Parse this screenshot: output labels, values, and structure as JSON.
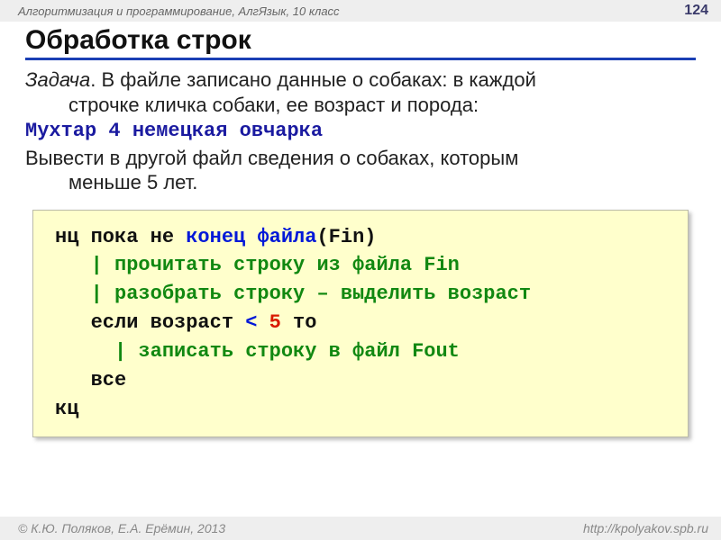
{
  "header": {
    "course": "Алгоритмизация и программирование, АлгЯзык, 10 класс",
    "page": "124"
  },
  "title": "Обработка строк",
  "task": {
    "label": "Задача",
    "line1_a": ". В файле записано данные о собаках: в каждой",
    "line1_b": "строчке кличка собаки, ее возраст и порода:",
    "sample": "Мухтар 4 немецкая овчарка",
    "line2_a": "Вывести в другой файл сведения о собаках, которым",
    "line2_b": "меньше 5 лет."
  },
  "code": {
    "l1_a": "нц пока не ",
    "l1_b": "конец файла",
    "l1_c": "(Fin)",
    "l2": "   | прочитать строку из файла Fin",
    "l3": "   | разобрать строку – выделить возраст",
    "l4_a": "   если возраст ",
    "l4_b": "<",
    "l4_c": " ",
    "l4_d": "5",
    "l4_e": " то",
    "l5": "     | записать строку в файл Fout",
    "l6": "   все",
    "l7": "кц"
  },
  "footer": {
    "copyright": "© К.Ю. Поляков, Е.А. Ерёмин, 2013",
    "url": "http://kpolyakov.spb.ru"
  }
}
